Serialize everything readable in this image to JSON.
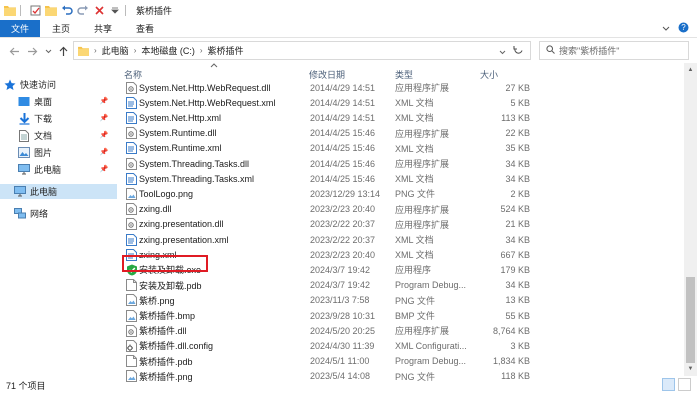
{
  "window": {
    "title": "紫桥插件"
  },
  "ribbon": {
    "tabs": [
      "文件",
      "主页",
      "共享",
      "查看"
    ]
  },
  "address": {
    "crumbs": [
      "此电脑",
      "本地磁盘 (C:)",
      "紫桥插件"
    ]
  },
  "search": {
    "placeholder": "搜索\"紫桥插件\""
  },
  "nav": {
    "quick_access": "快速访问",
    "desktop": "桌面",
    "downloads": "下载",
    "documents": "文档",
    "pictures": "图片",
    "this_pc_sub": "此电脑",
    "this_pc": "此电脑",
    "network": "网络"
  },
  "columns": {
    "name": "名称",
    "modified": "修改日期",
    "type": "类型",
    "size": "大小"
  },
  "files": [
    {
      "name": "System.Net.Http.WebRequest.dll",
      "date": "2014/4/29 14:51",
      "type": "应用程序扩展",
      "size": "27 KB",
      "icon": "dll-icon"
    },
    {
      "name": "System.Net.Http.WebRequest.xml",
      "date": "2014/4/29 14:51",
      "type": "XML 文档",
      "size": "5 KB",
      "icon": "xml-file-icon"
    },
    {
      "name": "System.Net.Http.xml",
      "date": "2014/4/29 14:51",
      "type": "XML 文档",
      "size": "113 KB",
      "icon": "xml-file-icon"
    },
    {
      "name": "System.Runtime.dll",
      "date": "2014/4/25 15:46",
      "type": "应用程序扩展",
      "size": "22 KB",
      "icon": "dll-icon"
    },
    {
      "name": "System.Runtime.xml",
      "date": "2014/4/25 15:46",
      "type": "XML 文档",
      "size": "35 KB",
      "icon": "xml-file-icon"
    },
    {
      "name": "System.Threading.Tasks.dll",
      "date": "2014/4/25 15:46",
      "type": "应用程序扩展",
      "size": "34 KB",
      "icon": "dll-icon"
    },
    {
      "name": "System.Threading.Tasks.xml",
      "date": "2014/4/25 15:46",
      "type": "XML 文档",
      "size": "34 KB",
      "icon": "xml-file-icon"
    },
    {
      "name": "ToolLogo.png",
      "date": "2023/12/29 13:14",
      "type": "PNG 文件",
      "size": "2 KB",
      "icon": "png-file-icon"
    },
    {
      "name": "zxing.dll",
      "date": "2023/2/23 20:40",
      "type": "应用程序扩展",
      "size": "524 KB",
      "icon": "dll-icon"
    },
    {
      "name": "zxing.presentation.dll",
      "date": "2023/2/22 20:37",
      "type": "应用程序扩展",
      "size": "21 KB",
      "icon": "dll-icon"
    },
    {
      "name": "zxing.presentation.xml",
      "date": "2023/2/22 20:37",
      "type": "XML 文档",
      "size": "34 KB",
      "icon": "xml-file-icon"
    },
    {
      "name": "zxing.xml",
      "date": "2023/2/23 20:40",
      "type": "XML 文档",
      "size": "667 KB",
      "icon": "xml-file-icon"
    },
    {
      "name": "安装及卸载.exe",
      "date": "2024/3/7 19:42",
      "type": "应用程序",
      "size": "179 KB",
      "icon": "shield-check-icon"
    },
    {
      "name": "安装及卸载.pdb",
      "date": "2024/3/7 19:42",
      "type": "Program Debug...",
      "size": "34 KB",
      "icon": "blank-file-icon"
    },
    {
      "name": "紫桥.png",
      "date": "2023/11/3 7:58",
      "type": "PNG 文件",
      "size": "13 KB",
      "icon": "png-file-icon"
    },
    {
      "name": "紫桥插件.bmp",
      "date": "2023/9/28 10:31",
      "type": "BMP 文件",
      "size": "55 KB",
      "icon": "png-file-icon"
    },
    {
      "name": "紫桥插件.dll",
      "date": "2024/5/20 20:25",
      "type": "应用程序扩展",
      "size": "8,764 KB",
      "icon": "dll-icon"
    },
    {
      "name": "紫桥插件.dll.config",
      "date": "2024/4/30 11:39",
      "type": "XML Configurati...",
      "size": "3 KB",
      "icon": "config-file-icon"
    },
    {
      "name": "紫桥插件.pdb",
      "date": "2024/5/1 11:00",
      "type": "Program Debug...",
      "size": "1,834 KB",
      "icon": "blank-file-icon"
    },
    {
      "name": "紫桥插件.png",
      "date": "2023/5/4 14:08",
      "type": "PNG 文件",
      "size": "118 KB",
      "icon": "png-file-icon"
    }
  ],
  "status": {
    "count": "71 个项目"
  },
  "colors": {
    "accent": "#1a6fc9",
    "highlight_box": "#e01b24",
    "selection": "#cce4f7"
  }
}
